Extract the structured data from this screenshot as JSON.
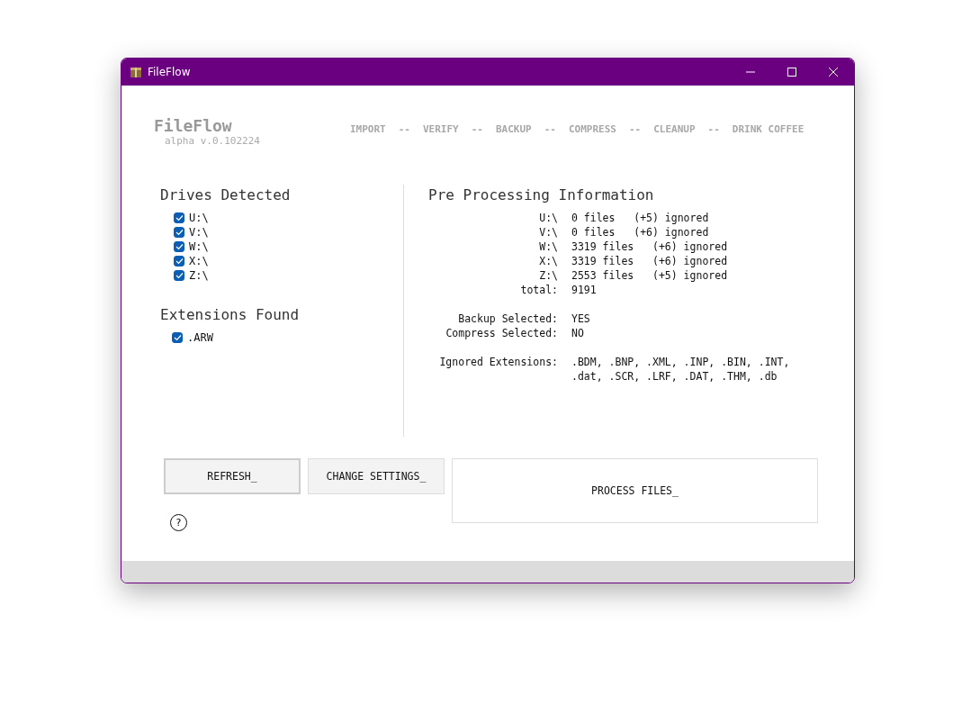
{
  "window": {
    "title": "FileFlow"
  },
  "app": {
    "name": "FileFlow",
    "version": "alpha v.0.102224"
  },
  "steps": [
    {
      "label": "IMPORT",
      "separator": "--"
    },
    {
      "label": "VERIFY",
      "separator": "--"
    },
    {
      "label": "BACKUP",
      "separator": "--"
    },
    {
      "label": "COMPRESS",
      "separator": "--"
    },
    {
      "label": "CLEANUP",
      "separator": "--"
    },
    {
      "label": "DRINK COFFEE"
    }
  ],
  "drives": {
    "title": "Drives Detected",
    "items": [
      {
        "label": "U:\\",
        "checked": true
      },
      {
        "label": "V:\\",
        "checked": true
      },
      {
        "label": "W:\\",
        "checked": true
      },
      {
        "label": "X:\\",
        "checked": true
      },
      {
        "label": "Z:\\",
        "checked": true
      }
    ]
  },
  "extensions": {
    "title": "Extensions Found",
    "items": [
      {
        "label": ".ARW",
        "checked": true
      }
    ]
  },
  "info": {
    "title": "Pre Processing Information",
    "drive_rows": [
      {
        "label": "U:\\",
        "value": "0 files   (+5) ignored"
      },
      {
        "label": "V:\\",
        "value": "0 files   (+6) ignored"
      },
      {
        "label": "W:\\",
        "value": "3319 files   (+6) ignored"
      },
      {
        "label": "X:\\",
        "value": "3319 files   (+6) ignored"
      },
      {
        "label": "Z:\\",
        "value": "2553 files   (+5) ignored"
      },
      {
        "label": "total:",
        "value": "9191"
      }
    ],
    "option_rows": [
      {
        "label": "Backup Selected:",
        "value": "YES"
      },
      {
        "label": "Compress Selected:",
        "value": "NO"
      }
    ],
    "ignored": {
      "label": "Ignored Extensions:",
      "lines": [
        ".BDM, .BNP, .XML, .INP, .BIN, .INT,",
        ".dat, .SCR, .LRF, .DAT, .THM, .db"
      ]
    }
  },
  "buttons": {
    "refresh": "REFRESH_",
    "settings": "CHANGE SETTINGS_",
    "process": "PROCESS FILES_",
    "help": "?"
  }
}
